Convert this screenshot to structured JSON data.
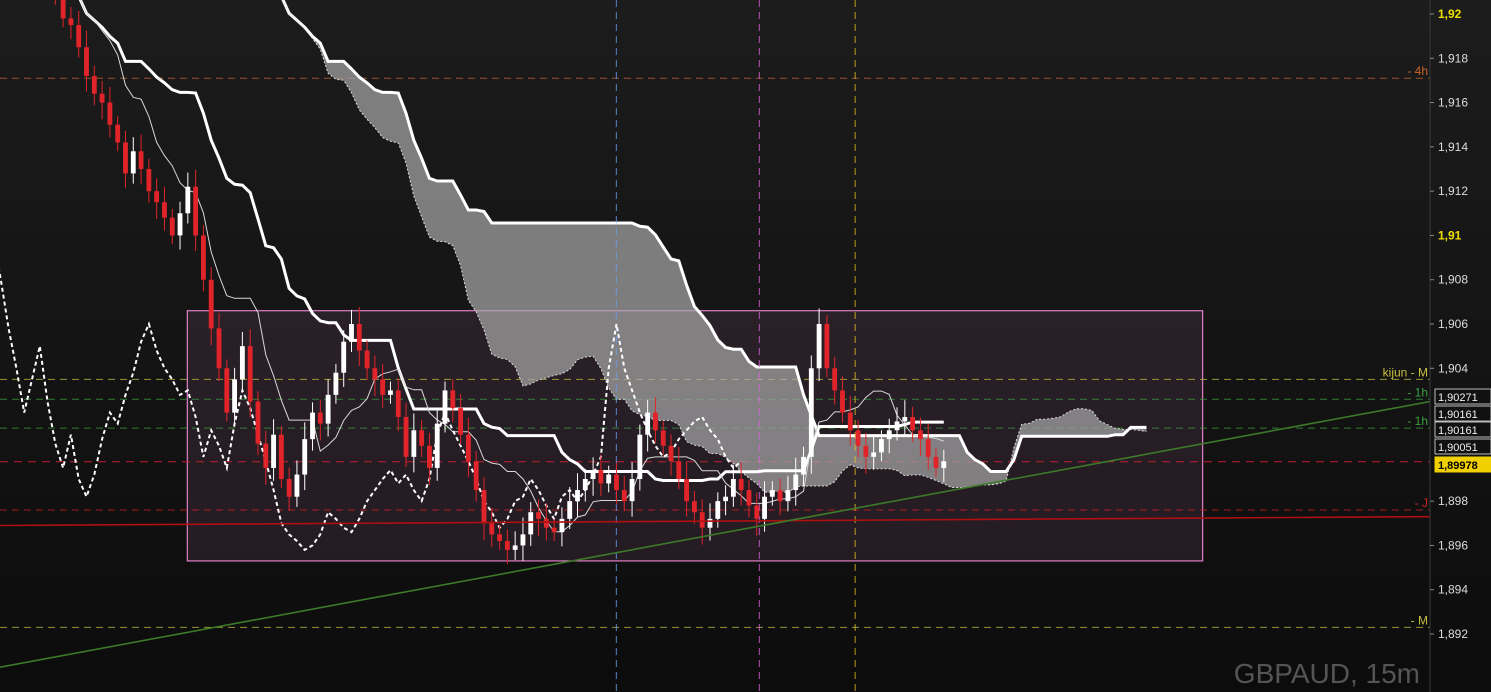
{
  "chart_data": {
    "type": "candlestick",
    "symbol": "GBPAUD",
    "timeframe": "15m",
    "symbol_label": "GBPAUD, 15m",
    "y_axis": {
      "min": 1.8912,
      "max": 1.9225,
      "ticks": [
        {
          "value": 1.892,
          "label": "1,892",
          "bold": false
        },
        {
          "value": 1.894,
          "label": "1,894",
          "bold": false
        },
        {
          "value": 1.896,
          "label": "1,896",
          "bold": false
        },
        {
          "value": 1.898,
          "label": "1,898",
          "bold": false
        },
        {
          "value": 1.904,
          "label": "1,904",
          "bold": false
        },
        {
          "value": 1.906,
          "label": "1,906",
          "bold": false
        },
        {
          "value": 1.908,
          "label": "1,908",
          "bold": false
        },
        {
          "value": 1.91,
          "label": "1,91",
          "bold": true
        },
        {
          "value": 1.912,
          "label": "1,912",
          "bold": false
        },
        {
          "value": 1.914,
          "label": "1,914",
          "bold": false
        },
        {
          "value": 1.916,
          "label": "1,916",
          "bold": false
        },
        {
          "value": 1.918,
          "label": "1,918",
          "bold": false
        },
        {
          "value": 1.92,
          "label": "1,92",
          "bold": true
        }
      ]
    },
    "levels": [
      {
        "name": "4h",
        "label": "- 4h",
        "value": 1.9171,
        "color": "#c8642a"
      },
      {
        "name": "kijun-m",
        "label": "kijun - M",
        "value": 1.9035,
        "color": "#c8c040"
      },
      {
        "name": "1h-a",
        "label": "- 1h",
        "value": 1.9026,
        "color": "#3aa040"
      },
      {
        "name": "1h-b",
        "label": "- 1h",
        "value": 1.9013,
        "color": "#3aa040"
      },
      {
        "name": "j",
        "label": "- J",
        "value": 1.8976,
        "color": "#d02020"
      },
      {
        "name": "m",
        "label": "- M",
        "value": 1.8923,
        "color": "#c8c040"
      }
    ],
    "price_tags": [
      {
        "label": "1,90271",
        "value": 1.90271,
        "kind": "normal"
      },
      {
        "label": "1,90161",
        "value": 1.90161,
        "kind": "normal"
      },
      {
        "label": "1,90161",
        "value": 1.90161,
        "kind": "normal"
      },
      {
        "label": "1,90051",
        "value": 1.90051,
        "kind": "normal"
      },
      {
        "label": "1,89978",
        "value": 1.89978,
        "kind": "current"
      },
      {
        "label": "1,89978",
        "value": 1.89978,
        "kind": "hidden"
      }
    ],
    "current_price": 1.89978,
    "range_box": {
      "x0": 0.131,
      "x1": 0.841,
      "y_top": 1.9066,
      "y_bottom": 1.8953
    },
    "vertical_markers": [
      {
        "x": 0.431,
        "color": "#6aa0ff"
      },
      {
        "x": 0.531,
        "color": "#e060e0"
      },
      {
        "x": 0.598,
        "color": "#e0c020"
      }
    ],
    "trendlines": [
      {
        "color": "#b01010",
        "p1": [
          0,
          1.8969
        ],
        "p2": [
          1,
          1.8973
        ]
      },
      {
        "color": "#3c7a2a",
        "p1": [
          0,
          1.8905
        ],
        "p2": [
          1,
          1.9025
        ]
      }
    ],
    "close_series": [
      1.9225,
      1.9222,
      1.9224,
      1.9228,
      1.9226,
      1.9218,
      1.921,
      1.9198,
      1.9195,
      1.9185,
      1.9172,
      1.9164,
      1.916,
      1.915,
      1.9142,
      1.9128,
      1.9138,
      1.913,
      1.912,
      1.9115,
      1.9108,
      1.91,
      1.911,
      1.9122,
      1.91,
      1.908,
      1.9058,
      1.904,
      1.902,
      1.9035,
      1.905,
      1.9025,
      1.9006,
      1.8995,
      1.901,
      1.899,
      1.8982,
      1.8992,
      1.9008,
      1.902,
      1.9015,
      1.9028,
      1.9038,
      1.9052,
      1.906,
      1.9048,
      1.904,
      1.9035,
      1.9028,
      1.903,
      1.9018,
      1.9,
      1.9012,
      1.9005,
      1.8995,
      1.9015,
      1.903,
      1.9022,
      1.901,
      1.8998,
      1.8985,
      1.897,
      1.8965,
      1.8962,
      1.8958,
      1.896,
      1.8965,
      1.8975,
      1.8972,
      1.8968,
      1.8966,
      1.8972,
      1.898,
      1.8985,
      1.899,
      1.8994,
      1.8988,
      1.8992,
      1.8985,
      1.898,
      1.899,
      1.901,
      1.902,
      1.9012,
      1.9005,
      1.8998,
      1.899,
      1.898,
      1.8975,
      1.8968,
      1.8972,
      1.898,
      1.8982,
      1.899,
      1.8985,
      1.8978,
      1.8972,
      1.8982,
      1.8985,
      1.898,
      1.8985,
      1.8992,
      1.9,
      1.904,
      1.906,
      1.904,
      1.903,
      1.902,
      1.9012,
      1.9005,
      1.9,
      1.9002,
      1.9008,
      1.9012,
      1.9016,
      1.9018,
      1.9012,
      1.9008,
      1.9,
      1.8995,
      1.8998
    ]
  }
}
